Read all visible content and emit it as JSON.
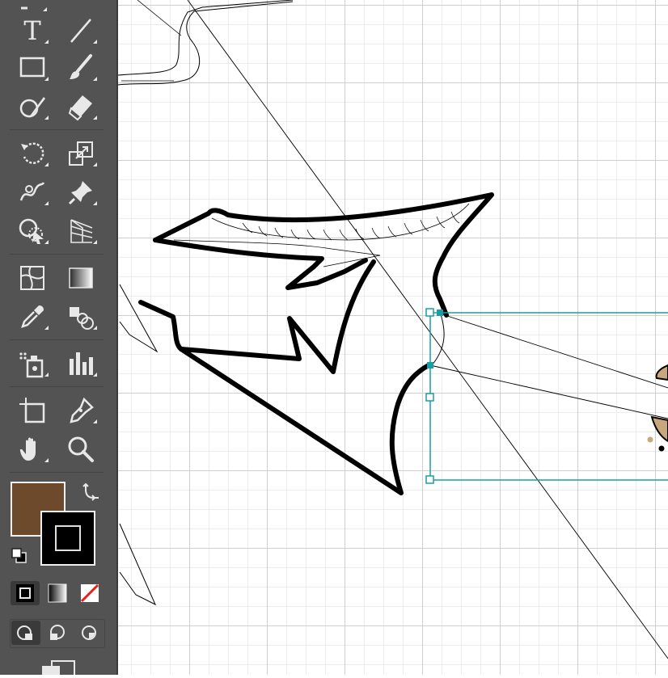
{
  "toolbar": {
    "tools": [
      {
        "name": "type-tool",
        "icon": "type-icon"
      },
      {
        "name": "line-segment-tool",
        "icon": "line-icon"
      },
      {
        "name": "rectangle-tool",
        "icon": "rectangle-icon"
      },
      {
        "name": "paintbrush-tool",
        "icon": "paintbrush-icon"
      },
      {
        "name": "shaper-tool",
        "icon": "shaper-icon"
      },
      {
        "name": "eraser-tool",
        "icon": "eraser-icon"
      },
      {
        "name": "rotate-tool",
        "icon": "rotate-icon"
      },
      {
        "name": "scale-tool",
        "icon": "scale-icon"
      },
      {
        "name": "warp-tool",
        "icon": "warp-icon"
      },
      {
        "name": "puppet-warp-tool",
        "icon": "pin-icon"
      },
      {
        "name": "shape-builder-tool",
        "icon": "shape-builder-icon"
      },
      {
        "name": "perspective-grid-tool",
        "icon": "perspective-grid-icon"
      },
      {
        "name": "mesh-tool",
        "icon": "mesh-icon"
      },
      {
        "name": "gradient-tool",
        "icon": "gradient-icon"
      },
      {
        "name": "eyedropper-tool",
        "icon": "eyedropper-icon"
      },
      {
        "name": "blend-tool",
        "icon": "blend-icon"
      },
      {
        "name": "symbol-sprayer-tool",
        "icon": "symbol-sprayer-icon"
      },
      {
        "name": "column-graph-tool",
        "icon": "column-graph-icon"
      },
      {
        "name": "artboard-tool",
        "icon": "artboard-icon"
      },
      {
        "name": "pen-tool",
        "icon": "pen-icon"
      },
      {
        "name": "hand-tool",
        "icon": "hand-icon"
      },
      {
        "name": "zoom-tool",
        "icon": "zoom-icon"
      }
    ],
    "type_glyph": "T",
    "fill_color": "#6e4a2c",
    "stroke_color": "#000000",
    "accent": "#1a9ea3"
  },
  "canvas": {
    "selection_color": "#1a9ea3",
    "shape_stroke_color": "#000000",
    "tan_accent": "#c9a77c"
  }
}
